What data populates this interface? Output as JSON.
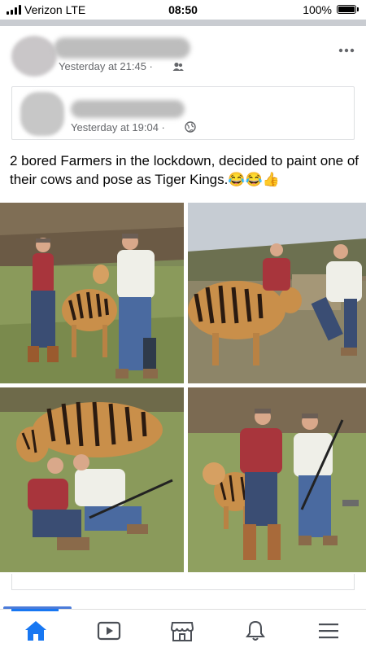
{
  "status_bar": {
    "carrier": "Verizon  LTE",
    "time": "08:50",
    "battery": "100%",
    "battery_level": 1.0
  },
  "post": {
    "timestamp": "Yesterday at 21:45 ·",
    "audience_icon": "friends-icon",
    "shared": {
      "timestamp": "Yesterday at 19:04 ·",
      "audience_icon": "globe-icon"
    },
    "caption": "2 bored Farmers in the lockdown, decided to paint one of their cows and pose as Tiger Kings.😂😂👍",
    "more_icon": "more-horizontal-icon"
  },
  "photos": [
    {
      "name": "photo-farmers-with-cow-1"
    },
    {
      "name": "photo-farmers-with-cow-2"
    },
    {
      "name": "photo-farmers-kneeling-with-cow"
    },
    {
      "name": "photo-farmers-standing-with-guns"
    }
  ],
  "nav": {
    "items": [
      {
        "icon": "home-icon",
        "active": true
      },
      {
        "icon": "video-icon",
        "active": false
      },
      {
        "icon": "marketplace-icon",
        "active": false
      },
      {
        "icon": "notifications-icon",
        "active": false
      },
      {
        "icon": "menu-icon",
        "active": false
      }
    ],
    "active_color": "#1877f2"
  }
}
